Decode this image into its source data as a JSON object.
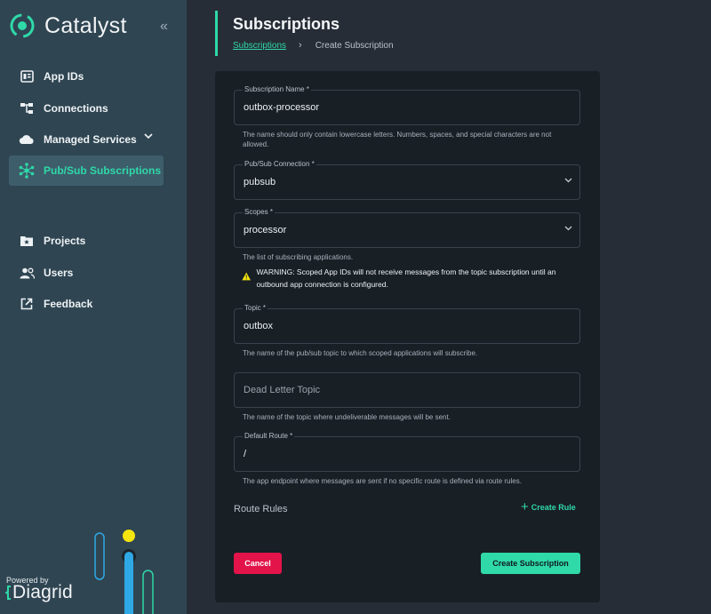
{
  "colors": {
    "accent": "#2fd9a8",
    "danger": "#e2144a",
    "sidebar": "#2f4552",
    "card": "#181f25",
    "warning": "#f5e50f"
  },
  "brand": {
    "name": "Catalyst",
    "logo_icon": "catalyst-logo-icon",
    "collapse_glyph": "«"
  },
  "sidebar": {
    "items": [
      {
        "label": "App IDs",
        "icon": "app-ids-icon"
      },
      {
        "label": "Connections",
        "icon": "connections-icon"
      },
      {
        "label": "Managed Services",
        "icon": "cloud-icon"
      },
      {
        "label": "Pub/Sub Subscriptions",
        "icon": "pubsub-icon",
        "active": true
      },
      {
        "label": "Projects",
        "icon": "folder-star-icon"
      },
      {
        "label": "Users",
        "icon": "users-icon"
      },
      {
        "label": "Feedback",
        "icon": "external-link-icon"
      }
    ],
    "powered_by": "Powered by",
    "partner": "Diagrid"
  },
  "header": {
    "title": "Subscriptions",
    "breadcrumb": {
      "link": "Subscriptions",
      "sep": "›",
      "current": "Create Subscription"
    }
  },
  "form": {
    "name": {
      "label": "Subscription Name *",
      "value": "outbox-processor",
      "help": "The name should only contain lowercase letters. Numbers, spaces, and special characters are not allowed."
    },
    "connection": {
      "label": "Pub/Sub Connection *",
      "value": "pubsub"
    },
    "scopes": {
      "label": "Scopes *",
      "value": "processor",
      "help": "The list of subscribing applications."
    },
    "warning": "WARNING: Scoped App IDs will not receive messages from the topic subscription until an outbound app connection is configured.",
    "topic": {
      "label": "Topic *",
      "value": "outbox",
      "help": "The name of the pub/sub topic to which scoped applications will subscribe."
    },
    "dead_letter": {
      "placeholder": "Dead Letter Topic",
      "help": "The name of the topic where undeliverable messages will be sent."
    },
    "default_route": {
      "label": "Default Route *",
      "value": "/",
      "help": "The app endpoint where messages are sent if no specific route is defined via route rules."
    },
    "route_rules": {
      "label": "Route Rules",
      "create_label": "Create Rule"
    },
    "cancel_label": "Cancel",
    "submit_label": "Create Subscription"
  }
}
